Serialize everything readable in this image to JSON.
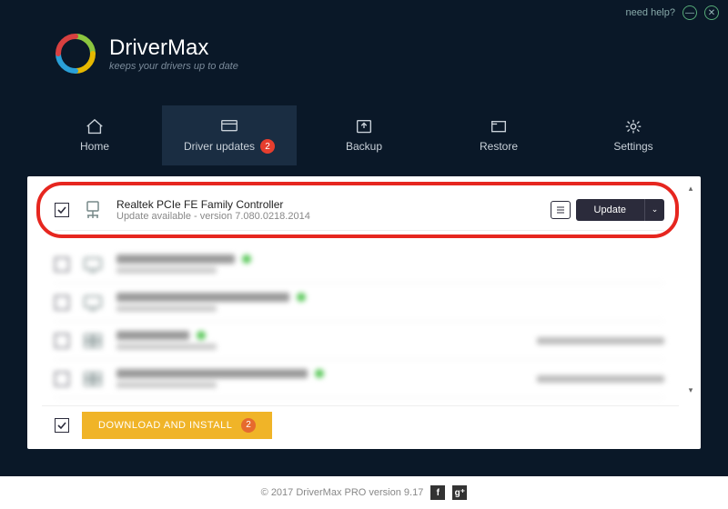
{
  "window": {
    "help_label": "need help?"
  },
  "brand": {
    "name": "DriverMax",
    "tagline": "keeps your drivers up to date"
  },
  "nav": {
    "home": "Home",
    "driver_updates": "Driver updates",
    "driver_updates_badge": "2",
    "backup": "Backup",
    "restore": "Restore",
    "settings": "Settings"
  },
  "featured_driver": {
    "name": "Realtek PCIe FE Family Controller",
    "status": "Update available - version 7.080.0218.2014",
    "update_label": "Update"
  },
  "blurred_rows": [
    {
      "title_w": 130,
      "icon": "monitor"
    },
    {
      "title_w": 190,
      "icon": "monitor"
    },
    {
      "title_w": 80,
      "icon": "window",
      "right_w": 140
    },
    {
      "title_w": 210,
      "icon": "window",
      "right_w": 140
    }
  ],
  "download": {
    "label": "DOWNLOAD AND INSTALL",
    "badge": "2"
  },
  "footer": {
    "copyright": "© 2017 DriverMax PRO version 9.17"
  }
}
